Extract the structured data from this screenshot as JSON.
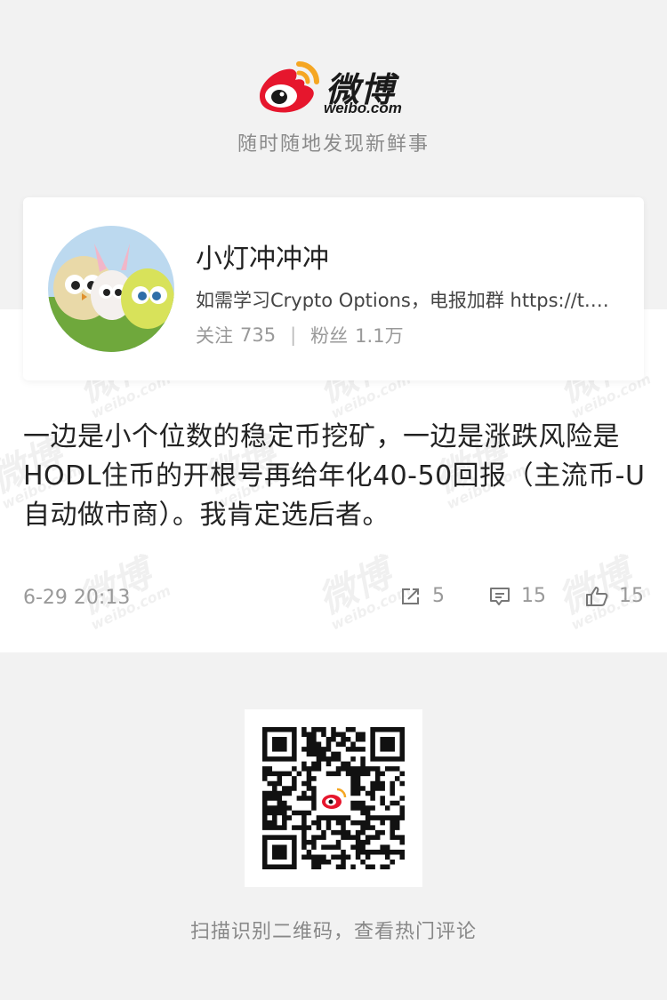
{
  "header": {
    "logo_cn": "微博",
    "logo_en": "weibo.com",
    "slogan": "随时随地发现新鲜事"
  },
  "user": {
    "name": "小灯冲冲冲",
    "bio": "如需学习Crypto Options，电报加群 https://t.me/...",
    "following_label": "关注",
    "following_count": "735",
    "separator": "|",
    "followers_label": "粉丝",
    "followers_count": "1.1万"
  },
  "post": {
    "text": "一边是小个位数的稳定币挖矿，一边是涨跌风险是HODL住币的开根号再给年化40-50回报（主流币-U自动做市商）。我肯定选后者。",
    "time": "6-29 20:13",
    "reposts": "5",
    "comments": "15",
    "likes": "15"
  },
  "watermark": {
    "cn": "微博",
    "en": "weibo.com"
  },
  "footer": {
    "qr_caption": "扫描识别二维码，查看热门评论"
  },
  "colors": {
    "page_bg": "#f2f2f2",
    "card_bg": "#ffffff",
    "text_primary": "#222222",
    "text_muted": "#999999",
    "weibo_red": "#e6162d",
    "weibo_orange": "#f5a623"
  }
}
